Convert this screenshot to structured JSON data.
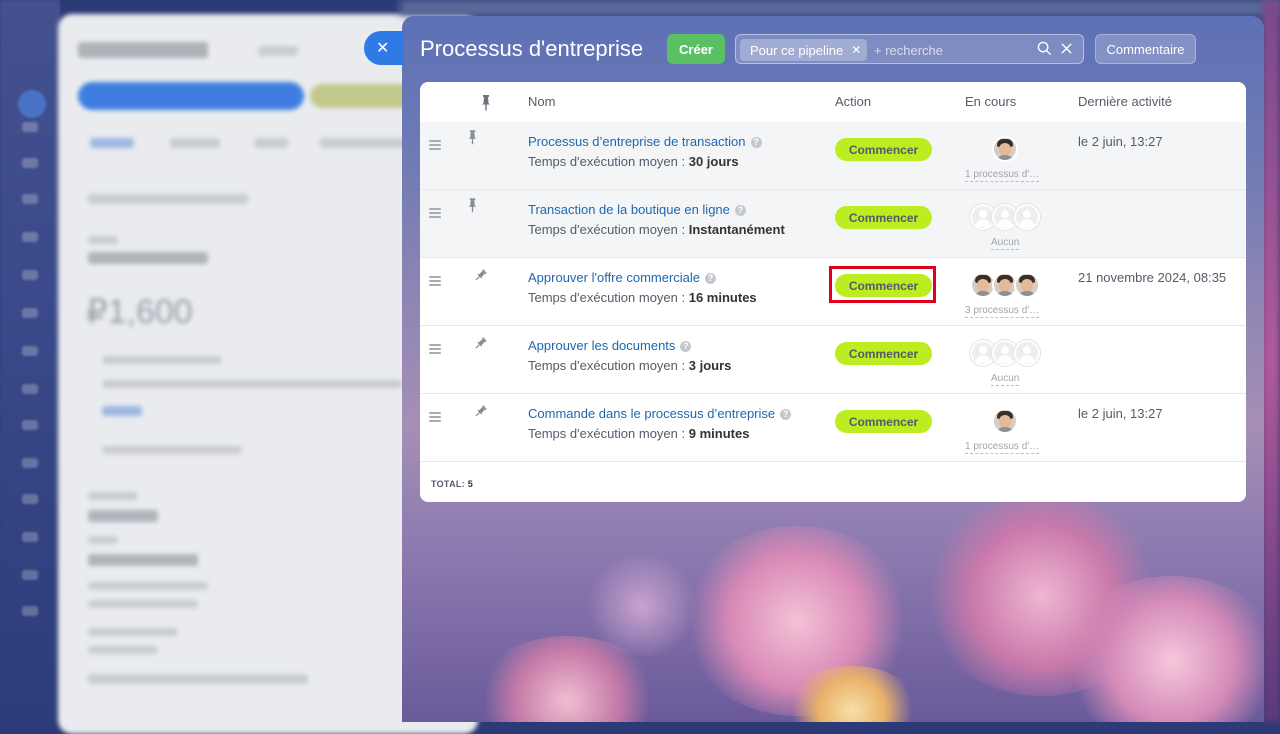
{
  "panel": {
    "title": "Processus d'entreprise",
    "close_glyph": "✕",
    "create_label": "Créer",
    "filter_chip": "Pour ce pipeline",
    "search_placeholder": "+ recherche",
    "comment_label": "Commentaire"
  },
  "table": {
    "headers": {
      "name": "Nom",
      "action": "Action",
      "running": "En cours",
      "last_activity": "Dernière activité"
    },
    "rows": [
      {
        "name": "Processus d’entreprise de transaction",
        "avg_label": "Temps d'exécution moyen : ",
        "avg_value": "30 jours",
        "action": "Commencer",
        "running": "1 processus d'…",
        "last_activity": "le 2 juin, 13:27"
      },
      {
        "name": "Transaction de la boutique en ligne",
        "avg_label": "Temps d'exécution moyen : ",
        "avg_value": "Instantanément",
        "action": "Commencer",
        "running": "Aucun",
        "last_activity": ""
      },
      {
        "name": "Approuver l'offre commerciale",
        "avg_label": "Temps d'exécution moyen : ",
        "avg_value": "16 minutes",
        "action": "Commencer",
        "running": "3 processus d'…",
        "last_activity": "21 novembre 2024, 08:35"
      },
      {
        "name": "Approuver les documents",
        "avg_label": "Temps d'exécution moyen : ",
        "avg_value": "3 jours",
        "action": "Commencer",
        "running": "Aucun",
        "last_activity": ""
      },
      {
        "name": "Commande dans le processus d’entreprise",
        "avg_label": "Temps d'exécution moyen : ",
        "avg_value": "9 minutes",
        "action": "Commencer",
        "running": "1 processus d'…",
        "last_activity": "le 2 juin, 13:27"
      }
    ],
    "total_label": "TOTAL: ",
    "total_value": "5"
  },
  "colors": {
    "accent": "#2f7be5",
    "create": "#5bbf63",
    "start_button": "#bbed21",
    "link": "#2067b0",
    "highlight": "#e0001b"
  }
}
